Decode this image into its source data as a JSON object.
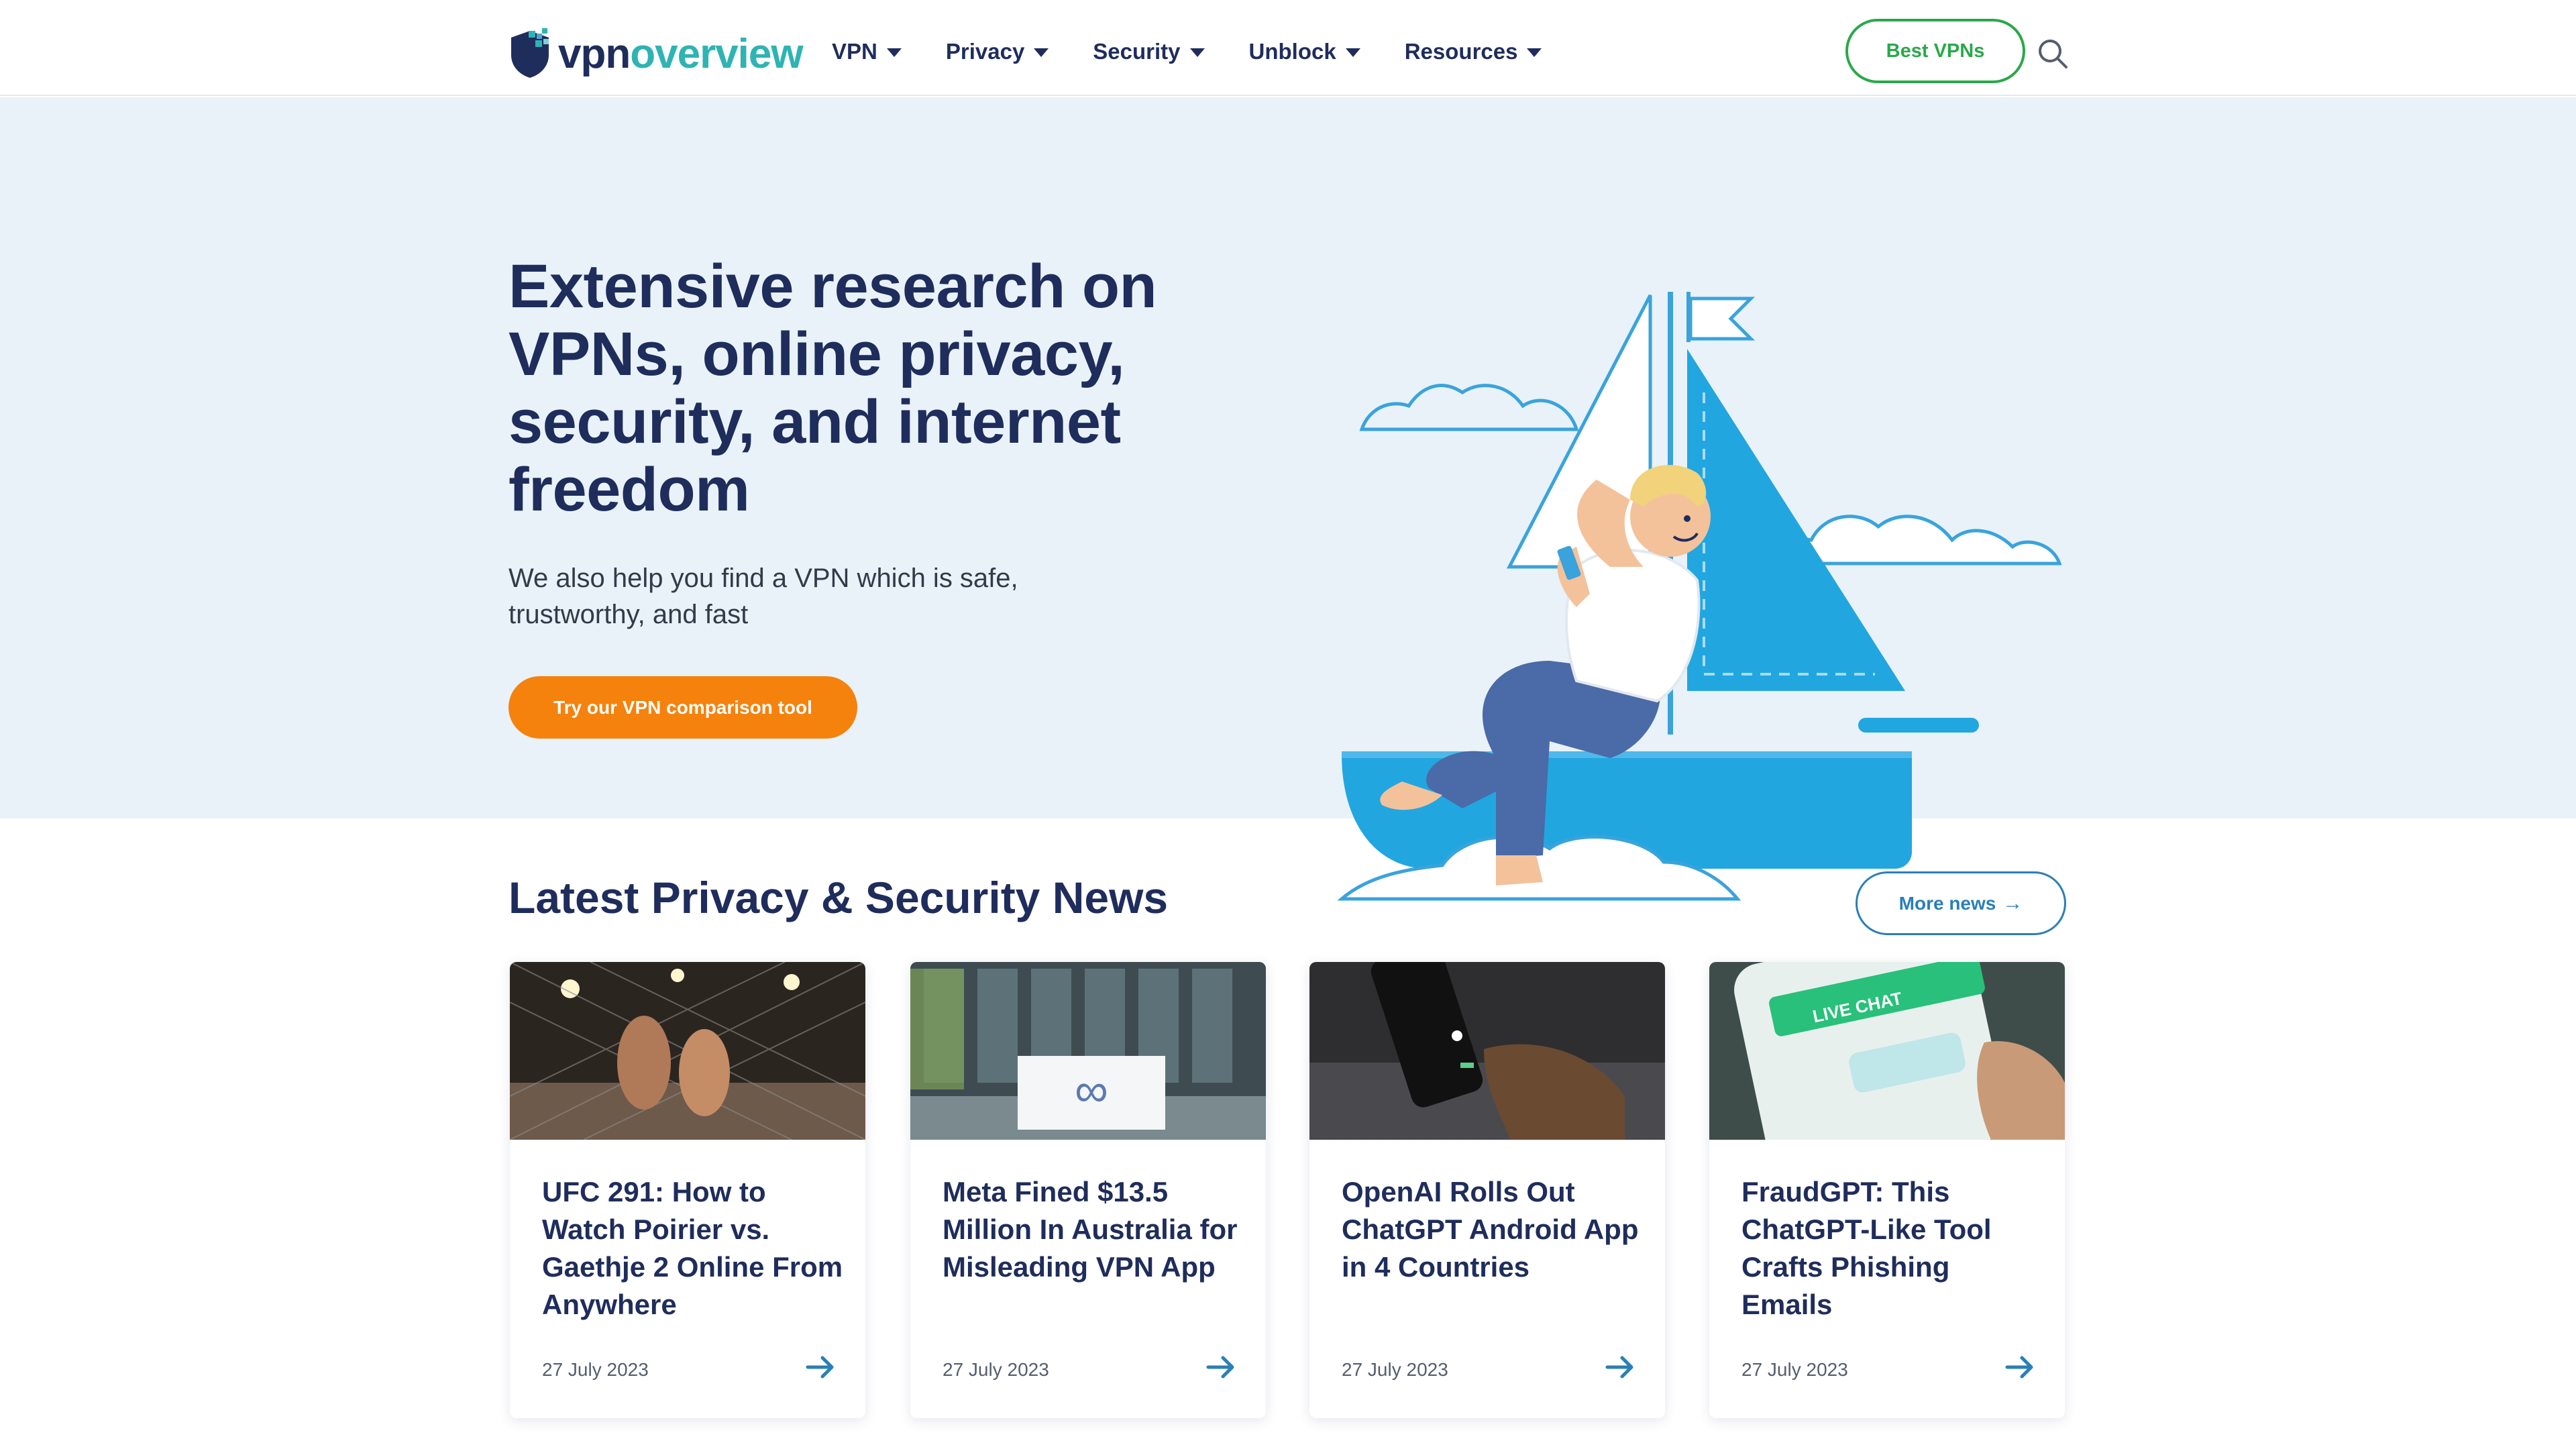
{
  "header": {
    "logo": {
      "part1": "vpn",
      "part2": "overview"
    },
    "nav": [
      {
        "label": "VPN"
      },
      {
        "label": "Privacy"
      },
      {
        "label": "Security"
      },
      {
        "label": "Unblock"
      },
      {
        "label": "Resources"
      }
    ],
    "best_vpns_label": "Best VPNs",
    "search_icon": "search-icon"
  },
  "hero": {
    "title": "Extensive research on VPNs, online privacy, security, and internet freedom",
    "subtitle": "We also help you find a VPN which is safe, trustworthy, and fast",
    "cta_label": "Try our VPN comparison tool"
  },
  "news": {
    "title": "Latest Privacy & Security News",
    "more_label": "More news",
    "cards": [
      {
        "title": "UFC 291: How to Watch Poirier vs. Gaethje 2 Online From Anywhere",
        "date": "27 July 2023"
      },
      {
        "title": "Meta Fined $13.5 Million In Australia for Misleading VPN App",
        "date": "27 July 2023"
      },
      {
        "title": "OpenAI Rolls Out ChatGPT Android App in 4 Countries",
        "date": "27 July 2023"
      },
      {
        "title": "FraudGPT: This ChatGPT-Like Tool Crafts Phishing Emails",
        "date": "27 July 2023"
      }
    ]
  },
  "colors": {
    "navy": "#1f2d5c",
    "teal": "#2fb3b3",
    "green": "#2aa84a",
    "orange": "#f5820d",
    "blue": "#2a7fb7",
    "hero_bg": "#e8f2f8"
  }
}
